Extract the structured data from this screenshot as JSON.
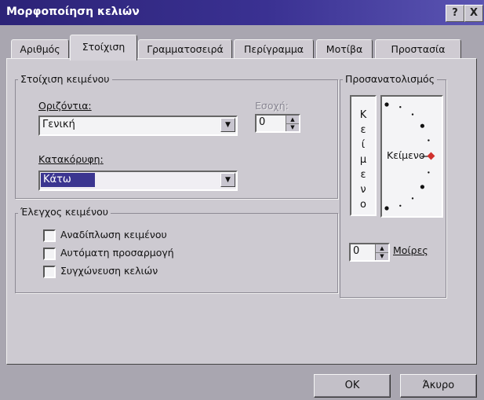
{
  "window": {
    "title": "Μορφοποίηση κελιών",
    "help_label": "?",
    "close_label": "X"
  },
  "tabs": [
    "Αριθμός",
    "Στοίχιση",
    "Γραμματοσειρά",
    "Περίγραμμα",
    "Μοτίβα",
    "Προστασία"
  ],
  "active_tab": "Στοίχιση",
  "alignment": {
    "group_label": "Στοίχιση κειμένου",
    "horizontal_label": "Οριζόντια:",
    "horizontal_value": "Γενική",
    "indent_label": "Εσοχή:",
    "indent_value": "0",
    "vertical_label": "Κατακόρυφη:",
    "vertical_value": "Κάτω"
  },
  "text_control": {
    "group_label": "Έλεγχος κειμένου",
    "options": [
      {
        "label": "Αναδίπλωση κειμένου",
        "checked": false
      },
      {
        "label": "Αυτόματη προσαρμογή",
        "checked": false
      },
      {
        "label": "Συγχώνευση κελιών",
        "checked": false
      }
    ]
  },
  "orientation": {
    "group_label": "Προσανατολισμός",
    "vertical_text": [
      "Κ",
      "ε",
      "ί",
      "μ",
      "ε",
      "ν",
      "ο"
    ],
    "dial_text": "Κείμενο",
    "degrees_value": "0",
    "degrees_label": "Μοίρες",
    "colors": {
      "marker": "#d0312d",
      "dot": "#111111"
    }
  },
  "footer": {
    "ok_label": "OK",
    "cancel_label": "Άκυρο"
  }
}
